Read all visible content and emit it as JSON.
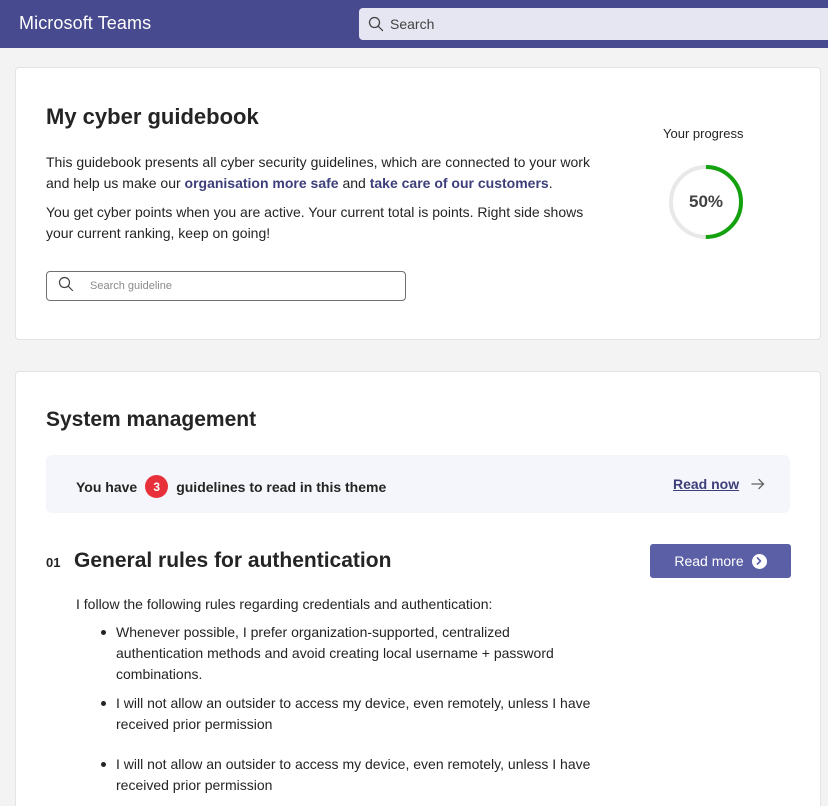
{
  "app": {
    "title": "Microsoft Teams"
  },
  "search": {
    "placeholder": "Search"
  },
  "guidebook": {
    "title": "My cyber guidebook",
    "intro_p1_part1": "This guidebook presents all cyber security guidelines, which are connected to your work and help us make our ",
    "intro_p1_link1": "organisation more safe",
    "intro_p1_part2": " and ",
    "intro_p1_link2": "take care of our customers",
    "intro_p1_part3": ".",
    "intro_p2": "You get cyber points when you are active. Your current total is points. Right side shows your current ranking, keep on going!",
    "search_placeholder": "Search guideline"
  },
  "progress": {
    "label": "Your progress",
    "value": 50,
    "value_text": "50%",
    "color": "#13a10e"
  },
  "theme": {
    "title": "System management",
    "notice_prefix": "You have",
    "unread_count": "3",
    "notice_suffix": "guidelines to read in this theme",
    "read_now": "Read now",
    "badge_color": "#e8303a"
  },
  "guideline": {
    "number": "01",
    "title": "General rules for authentication",
    "read_more": "Read more",
    "intro": "I follow the following rules regarding credentials and authentication:",
    "rules": [
      "Whenever possible, I prefer organization-supported, centralized authentication methods and avoid creating local username + password combinations.",
      "I will not allow an outsider to access my device, even remotely, unless I have received prior permission",
      "I will not allow an outsider to access my device, even remotely, unless I have received prior permission"
    ]
  },
  "accent_color": "#474a8e"
}
